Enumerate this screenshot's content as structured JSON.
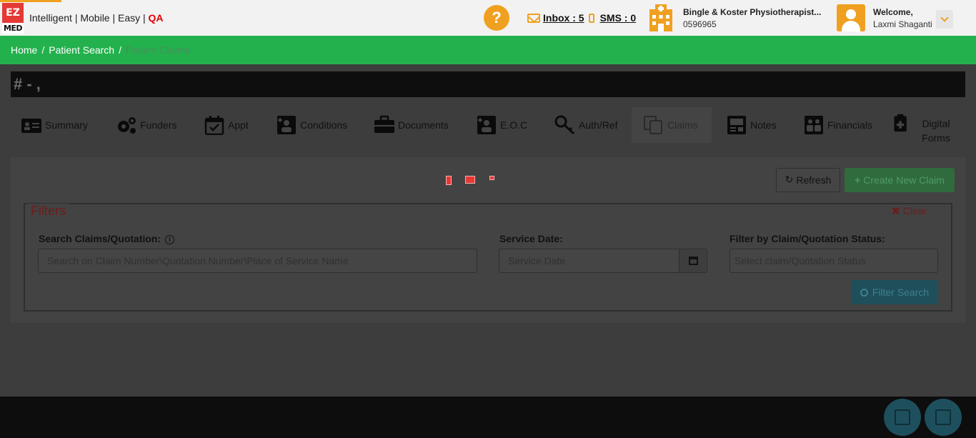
{
  "header": {
    "logo_top": "EZ",
    "logo_bottom": "MED",
    "tagline": "Intelligent | Mobile | Easy |",
    "environment": "QA",
    "help_label": "?",
    "inbox_label": "Inbox : 5",
    "sms_label": "SMS : 0",
    "clinic_name": "Bingle & Koster Physiotherapist...",
    "clinic_phone": "0596965",
    "welcome_label": "Welcome,",
    "user_name": "Laxmi Shaganti"
  },
  "breadcrumb": {
    "items": [
      "Home",
      "Patient Search"
    ],
    "current": "Patient Claims"
  },
  "patient_bar": {
    "title": "# - ,"
  },
  "tabs": [
    {
      "label": "Summary",
      "icon": "id-card-icon"
    },
    {
      "label": "Funders",
      "icon": "gears-icon"
    },
    {
      "label": "Appt",
      "icon": "calendar-check-icon"
    },
    {
      "label": "Conditions",
      "icon": "user-medical-icon"
    },
    {
      "label": "Documents",
      "icon": "briefcase-icon"
    },
    {
      "label": "E.O.C",
      "icon": "user-medical-icon"
    },
    {
      "label": "Auth/Ref",
      "icon": "key-icon"
    },
    {
      "label": "Claims",
      "icon": "copy-icon",
      "active": true
    },
    {
      "label": "Notes",
      "icon": "notes-icon"
    },
    {
      "label": "Financials",
      "icon": "users-money-icon"
    },
    {
      "label": "Digital Forms",
      "icon": "clipboard-plus-icon"
    }
  ],
  "toolbar": {
    "refresh_label": "Refresh",
    "create_label": "Create New Claim"
  },
  "filters": {
    "legend": "Filters",
    "clear_label": "Clear",
    "search_label": "Search Claims/Quotation:",
    "search_placeholder": "Search on Claim Number\\Quotation Number\\Place of Service Name",
    "service_date_label": "Service Date:",
    "service_date_placeholder": "Service Date",
    "status_label": "Filter by Claim/Quotation Status:",
    "status_placeholder": "Select claim/Quotation Status",
    "filter_button": "Filter Search"
  },
  "colors": {
    "brand_orange": "#f0a020",
    "breadcrumb_green": "#23b14d",
    "qa_red": "#e00000"
  }
}
